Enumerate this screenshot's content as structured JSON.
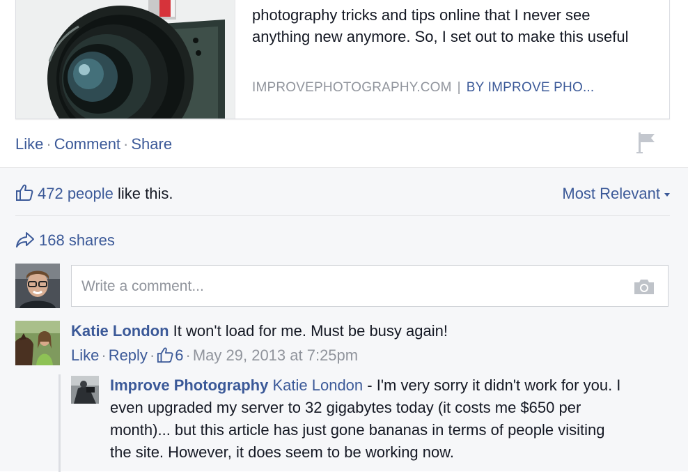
{
  "preview": {
    "description": "photography tricks and tips online that I never see anything new anymore. So, I set out to make this useful",
    "domain": "IMPROVEPHOTOGRAPHY.COM",
    "separator": "|",
    "author": "BY IMPROVE PHO..."
  },
  "post_actions": {
    "like": "Like",
    "comment": "Comment",
    "share": "Share",
    "dot": "·"
  },
  "likes": {
    "count_text": "472 people",
    "rest_text": "like this.",
    "icon": "thumbs-up-icon"
  },
  "sort": {
    "label": "Most Relevant",
    "icon": "caret-down-icon"
  },
  "shares": {
    "text": "168 shares",
    "icon": "share-arrow-icon"
  },
  "composer": {
    "placeholder": "Write a comment...",
    "value": "",
    "camera_icon": "camera-icon"
  },
  "comments": [
    {
      "author": "Katie London",
      "text": "It won't load for me. Must be busy again!",
      "actions": {
        "like": "Like",
        "reply": "Reply",
        "like_count": "6",
        "timestamp": "May 29, 2013 at 7:25pm"
      },
      "replies": [
        {
          "author": "Improve Photography",
          "mention": "Katie London",
          "text": " - I'm very sorry it didn't work for you. I even upgraded my server to 32 gigabytes today (it costs me $650 per month)... but this article has just gone bananas in terms of people visiting the site. However, it does seem to be working now."
        }
      ]
    }
  ],
  "colors": {
    "link": "#3b5998",
    "muted": "#90949c",
    "feedback_bg": "#f6f7f9"
  }
}
